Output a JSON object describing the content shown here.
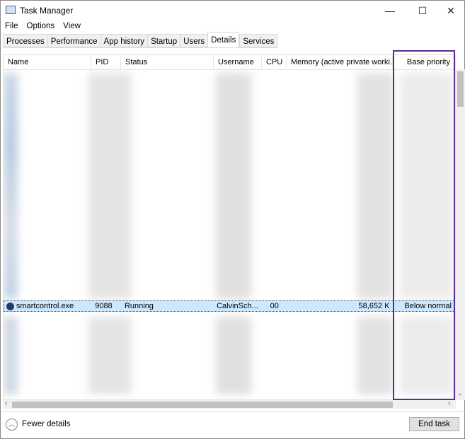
{
  "window": {
    "title": "Task Manager",
    "minimize": "—",
    "maximize": "☐",
    "close": "✕"
  },
  "menu": [
    "File",
    "Options",
    "View"
  ],
  "tabs": [
    "Processes",
    "Performance",
    "App history",
    "Startup",
    "Users",
    "Details",
    "Services"
  ],
  "active_tab": "Details",
  "columns": [
    "Name",
    "PID",
    "Status",
    "Username",
    "CPU",
    "Memory (active private worki...",
    "Base priority"
  ],
  "selected_row": {
    "name": "smartcontrol.exe",
    "pid": "9088",
    "status": "Running",
    "username": "CalvinSch...",
    "cpu": "00",
    "memory": "58,652 K",
    "base_priority": "Below normal"
  },
  "highlight_color": "#5c2d91",
  "footer": {
    "fewer_details": "Fewer details",
    "end_task": "End task"
  }
}
